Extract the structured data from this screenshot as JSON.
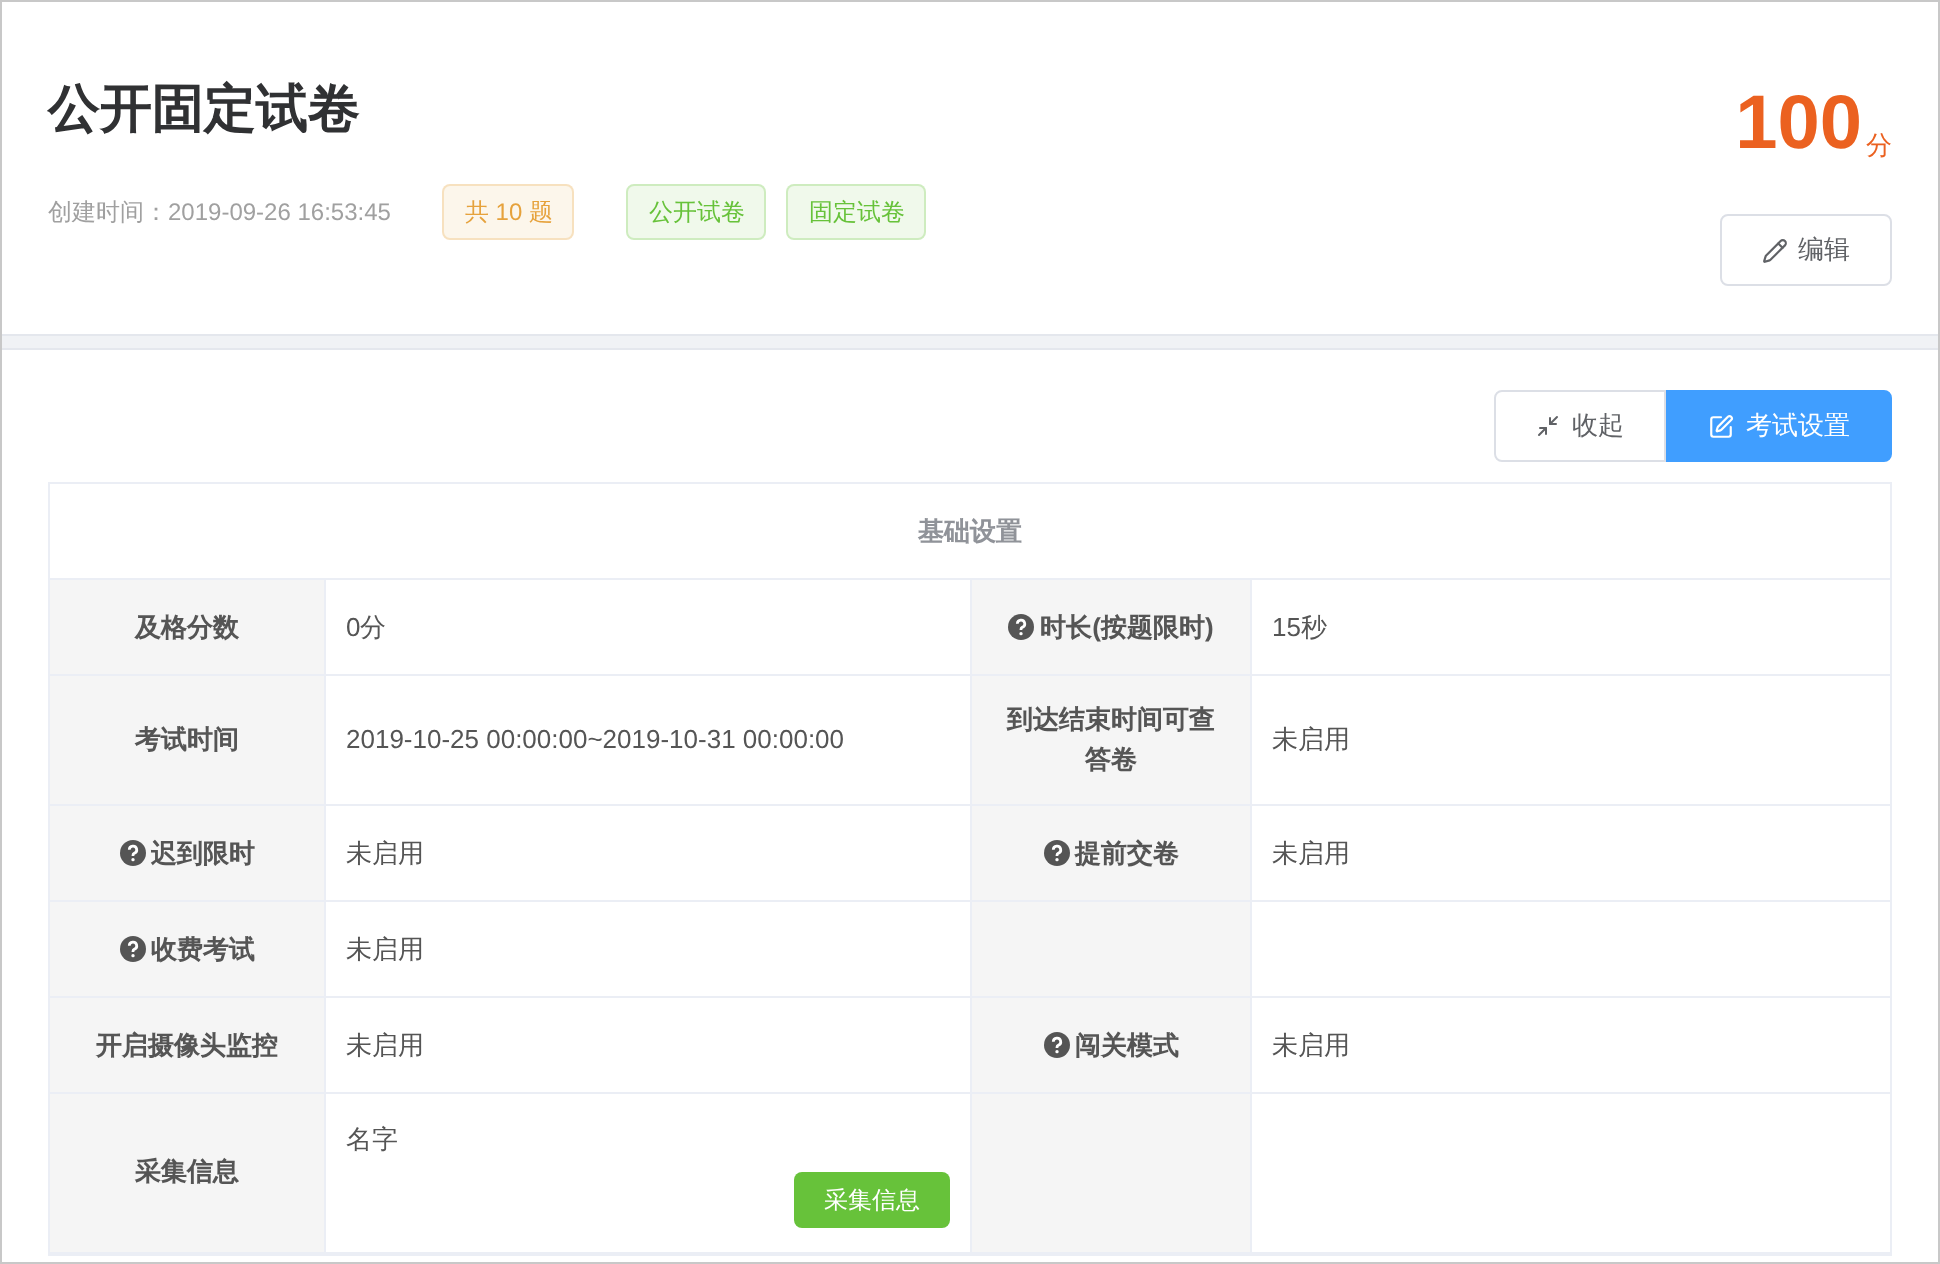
{
  "header": {
    "title": "公开固定试卷",
    "created": "创建时间：2019-09-26 16:53:45",
    "tags": [
      {
        "label": "共 10 题",
        "color": "#e6a23c"
      },
      {
        "label": "公开试卷",
        "color": "#67c23a"
      },
      {
        "label": "固定试卷",
        "color": "#67c23a"
      }
    ],
    "score": "100",
    "score_unit": "分",
    "edit_button": "编辑"
  },
  "toolbar": {
    "buttons": [
      {
        "label": "收起",
        "kind": "collapse"
      },
      {
        "label": "考试设置",
        "kind": "settings"
      }
    ]
  },
  "table": {
    "title": "基础设置",
    "rows": [
      {
        "cells": [
          {
            "label": "及格分数",
            "help": false,
            "value": "0分"
          },
          {
            "label": "时长(按题限时)",
            "help": true,
            "value": "15秒"
          }
        ]
      },
      {
        "cells": [
          {
            "label": "考试时间",
            "help": false,
            "value": "2019-10-25 00:00:00~2019-10-31 00:00:00"
          },
          {
            "label": "到达结束时间可查答卷",
            "help": false,
            "value": "未启用"
          }
        ]
      },
      {
        "cells": [
          {
            "label": "迟到限时",
            "help": true,
            "value": "未启用"
          },
          {
            "label": "提前交卷",
            "help": true,
            "value": "未启用"
          }
        ]
      },
      {
        "cells": [
          {
            "label": "收费考试",
            "help": true,
            "value": "未启用"
          },
          {}
        ]
      },
      {
        "cells": [
          {
            "label": "开启摄像头监控",
            "help": false,
            "value": "未启用"
          },
          {
            "label": "闯关模式",
            "help": true,
            "value": "未启用"
          }
        ]
      },
      {
        "cells": [
          {
            "label": "采集信息",
            "help": false,
            "value": "名字",
            "action": "采集信息"
          },
          {}
        ]
      }
    ]
  }
}
